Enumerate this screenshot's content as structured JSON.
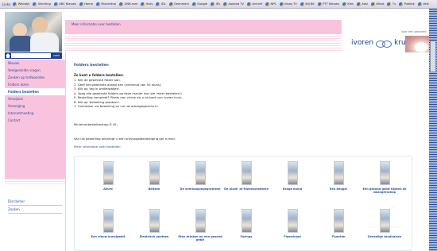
{
  "linksbar": {
    "label": "Links",
    "items": [
      "Wikiwijk",
      "Stichting",
      "ABC Nieuws",
      "Home",
      "Mixcentral",
      "GNR.com",
      "Ihuis",
      "IDL",
      "Geenmerk",
      "Google",
      "IFA",
      "Aanbod TV",
      "Archief",
      "NPS",
      "Inbox TV",
      "Wij Bit",
      "PTT Nieuws",
      "Kies",
      "Adsl",
      "Winst",
      "Tv",
      "Publiek",
      "Valk"
    ]
  },
  "header": {
    "top_link": "Meer informatie over bestellen",
    "logo_word1": "ivoren",
    "logo_word2": "kruis",
    "logo_tagline": "Voor een gezonde"
  },
  "search": {
    "placeholder": "",
    "go_label": "zoek"
  },
  "nav": {
    "items": [
      {
        "label": "Nieuws",
        "active": false
      },
      {
        "label": "Veelgestelde vragen",
        "active": false
      },
      {
        "label": "Zoeken op trefwoorden",
        "active": false
      },
      {
        "label": "Folders lezen",
        "active": false
      },
      {
        "label": "Folders bestellen",
        "active": true
      },
      {
        "label": "Verwijzen",
        "active": false
      },
      {
        "label": "Vereniging",
        "active": false
      },
      {
        "label": "Internetmeeting",
        "active": false
      },
      {
        "label": "Contact",
        "active": false
      }
    ],
    "secondary": [
      "Disclaimer",
      "Zoeken"
    ]
  },
  "main": {
    "title": "Folders bestellen",
    "subhead": "Zo kunt u folders bestellen:",
    "steps": [
      "1. Klik de gewenste folder aan.",
      "2. Geef het gewenste aantal aan (veelvoud van 50 stuks).",
      "3. Klik op 'leg in winkelwagen'.",
      "4. Voeg alle gewenste folders op deze manier toe (zie 'meer bestellen').",
      "5. Bestelling compleet? Plaats een vinkje als u bij bent van Ivoren kruis.",
      "6. Klik op 'bestelling plaatsen'.",
      "7. Controleer uw bestelling en vul uw adresgegevens in."
    ],
    "minimum": "Minimumbestelbedrag: € 45,-",
    "confirmation": "Van uw bestelling ontvangt u een ontvangstbevestiging per e-mail.",
    "more_link": "Meer informatie over bestellen"
  },
  "folders": [
    {
      "label": "Allure"
    },
    {
      "label": "Beitsen"
    },
    {
      "label": "De overkappingsprothese"
    },
    {
      "label": "De plaat- of framesprothese"
    },
    {
      "label": "Droge mond"
    },
    {
      "label": "Een beugel"
    },
    {
      "label": "Een gezond gebit tijdens de zwangerschap"
    },
    {
      "label": "Een nieuw kunstgebit"
    },
    {
      "label": "Elektrisch poetsen"
    },
    {
      "label": "Eten drinken en een gezond gebit"
    },
    {
      "label": "Facings"
    },
    {
      "label": "Flossdraad"
    },
    {
      "label": "Fluoride"
    },
    {
      "label": "Gevoelige tandhalsen"
    }
  ]
}
